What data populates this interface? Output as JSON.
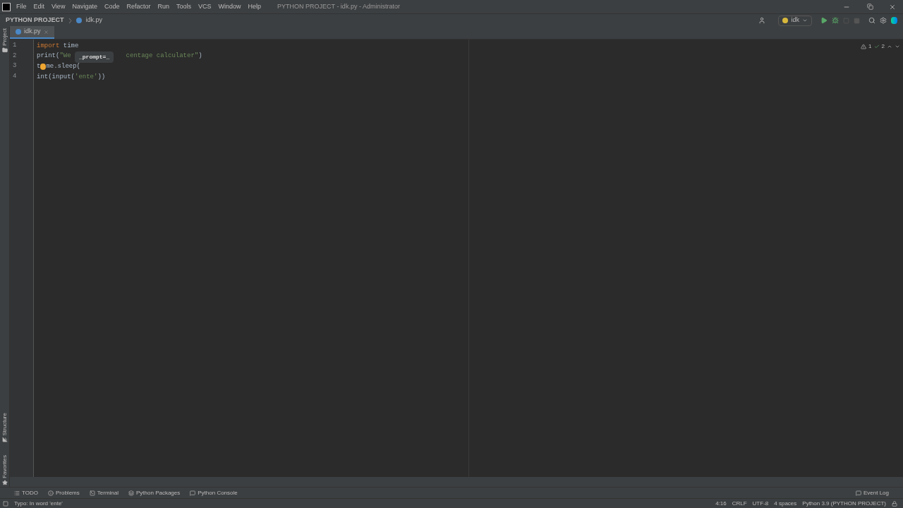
{
  "menu": [
    "File",
    "Edit",
    "View",
    "Navigate",
    "Code",
    "Refactor",
    "Run",
    "Tools",
    "VCS",
    "Window",
    "Help"
  ],
  "window": {
    "title": "PYTHON PROJECT - idk.py - Administrator"
  },
  "breadcrumbs": [
    "PYTHON PROJECT",
    "idk.py"
  ],
  "run_config": "idk",
  "tabs": [
    {
      "label": "idk.py",
      "selected": true
    }
  ],
  "left_tools": [
    "Project",
    "Structure",
    "Favorites"
  ],
  "inspections": {
    "warnings": "1",
    "typos": "2"
  },
  "lines": [
    {
      "number": "1",
      "segments": [
        {
          "kind": "keyword",
          "text": "import"
        },
        {
          "kind": "plain",
          "text": " time"
        }
      ]
    },
    {
      "number": "2",
      "segments": [
        {
          "kind": "plain",
          "text": "print("
        },
        {
          "kind": "string",
          "text": "\"We"
        },
        {
          "kind": "gap"
        },
        {
          "kind": "string",
          "text": "centage calculater\""
        },
        {
          "kind": "plain",
          "text": ")"
        }
      ]
    },
    {
      "number": "3",
      "segments": [
        {
          "kind": "plain",
          "text": "t"
        },
        {
          "kind": "bulb"
        },
        {
          "kind": "plain",
          "text": "me.sleep("
        }
      ]
    },
    {
      "number": "4",
      "segments": [
        {
          "kind": "plain",
          "text": "int(input("
        },
        {
          "kind": "string",
          "text": "'ente'"
        },
        {
          "kind": "plain",
          "text": "))"
        }
      ]
    }
  ],
  "hint_popup": "_prompt=_",
  "tool_tabs": [
    "TODO",
    "Problems",
    "Terminal",
    "Python Packages",
    "Python Console"
  ],
  "event_log": "Event Log",
  "status": {
    "message": "Typo: In word 'ente'",
    "items": [
      "4:16",
      "CRLF",
      "UTF-8",
      "4 spaces",
      "Python 3.9 (PYTHON PROJECT)"
    ]
  }
}
